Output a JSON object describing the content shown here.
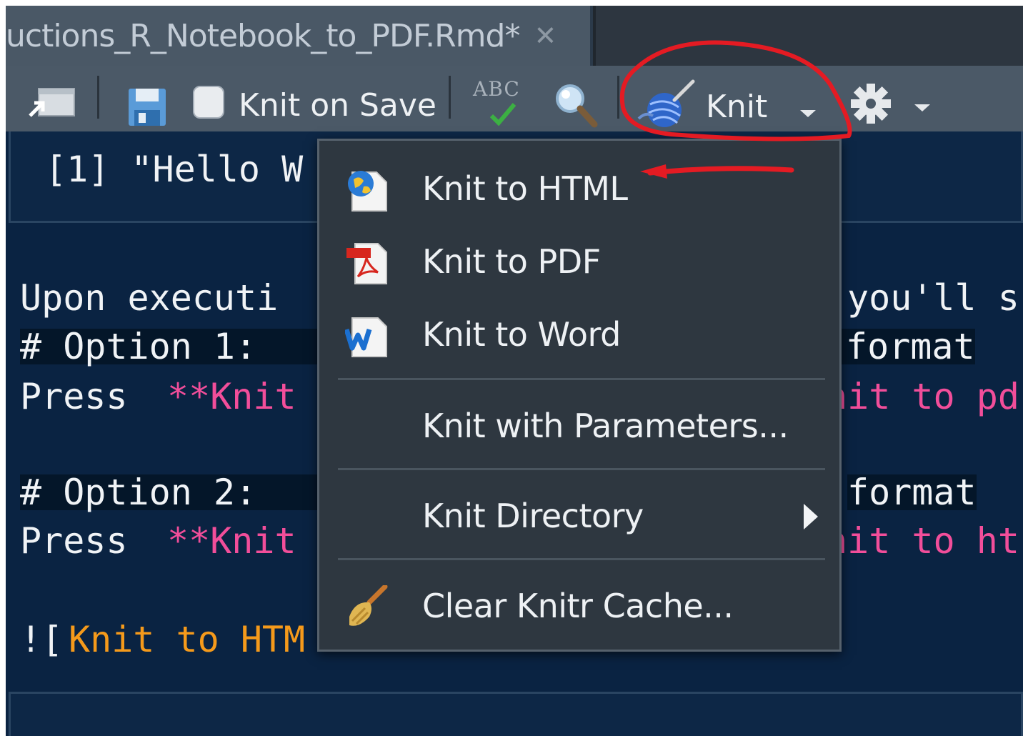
{
  "tab": {
    "title": "uctions_R_Notebook_to_PDF.Rmd*",
    "close_glyph": "✕"
  },
  "toolbar": {
    "knit_on_save_label": "Knit on Save",
    "spellcheck_text": "ABC",
    "knit_label": "Knit"
  },
  "editor": {
    "output_line": "[1] \"Hello W",
    "lines": {
      "l1": "Upon executi",
      "l1_tail": "you'll s",
      "l2_prefix": "# Option 1: ",
      "l2_tail": "format",
      "l3_prefix": "Press ",
      "l3_pink": "**Knit",
      "l3_tail": "nit to pd",
      "l4_prefix": "# Option 2: ",
      "l4_tail": "format",
      "l5_prefix": "Press ",
      "l5_pink": "**Knit",
      "l5_tail": "nit to ht",
      "l6_prefix": "![",
      "l6_orange": "Knit to HTM"
    }
  },
  "menu": {
    "items": [
      {
        "label": "Knit to HTML",
        "icon": "globe-page-icon"
      },
      {
        "label": "Knit to PDF",
        "icon": "pdf-document-icon"
      },
      {
        "label": "Knit to Word",
        "icon": "word-document-icon"
      },
      {
        "label": "Knit with Parameters..."
      },
      {
        "label": "Knit Directory",
        "icon": "chevron-right-icon"
      },
      {
        "label": "Clear Knitr Cache...",
        "icon": "broom-icon"
      }
    ]
  },
  "colors": {
    "editor_bg": "#0a2342",
    "toolbar_bg": "#4b5967",
    "menu_bg": "#2e3740",
    "pink_text": "#f24e9a",
    "orange_text": "#f59a1b",
    "annotation_red": "#e41b23"
  }
}
